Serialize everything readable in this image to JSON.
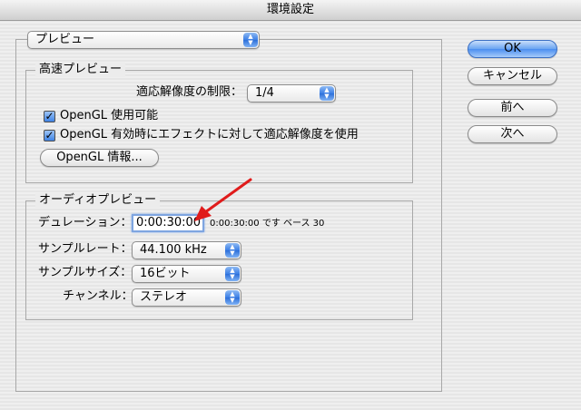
{
  "window": {
    "title": "環境設定"
  },
  "section_popup": {
    "value": "プレビュー"
  },
  "high_speed_preview": {
    "title": "高速プレビュー",
    "resolution_limit_label": "適応解像度の制限：",
    "resolution_limit_value": "1/4",
    "opengl_enabled_label": "OpenGL 使用可能",
    "opengl_enabled_checked": true,
    "opengl_effects_label": "OpenGL 有効時にエフェクトに対して適応解像度を使用",
    "opengl_effects_checked": true,
    "opengl_info_button": "OpenGL 情報..."
  },
  "audio_preview": {
    "title": "オーディオプレビュー",
    "duration_label": "デュレーション：",
    "duration_value": "0:00:30:00",
    "duration_note": "0:00:30:00 です  ベース 30",
    "sample_rate_label": "サンプルレート：",
    "sample_rate_value": "44.100 kHz",
    "sample_size_label": "サンプルサイズ：",
    "sample_size_value": "16ビット",
    "channel_label": "チャンネル：",
    "channel_value": "ステレオ"
  },
  "buttons": {
    "ok": "OK",
    "cancel": "キャンセル",
    "previous": "前へ",
    "next": "次へ"
  },
  "colors": {
    "accent_blue": "#4b8ef0",
    "annotation_red": "#e01b1b"
  },
  "icons": {
    "popup_arrows": "up-down-arrows-icon",
    "checkmark": "checkmark-icon",
    "annotation_arrow": "red-arrow-icon"
  }
}
